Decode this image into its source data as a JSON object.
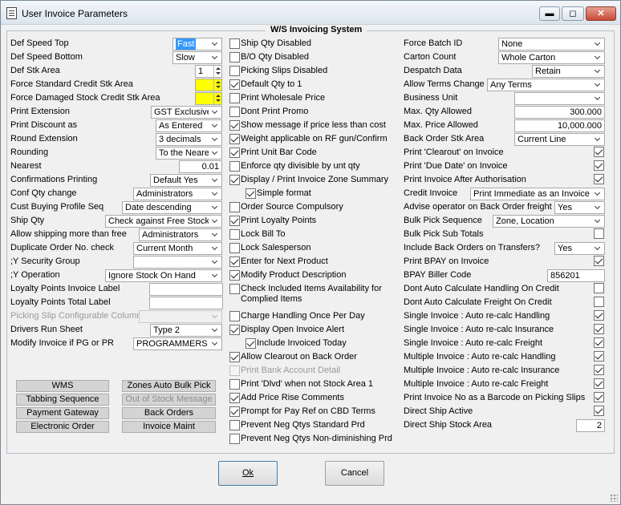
{
  "window": {
    "title": "User Invoice Parameters",
    "minimize": "▬",
    "maximize": "◻",
    "close": "✕"
  },
  "group_title": "W/S Invoicing System",
  "left": {
    "def_speed_top": {
      "label": "Def Speed Top",
      "value": "Fast"
    },
    "def_speed_bottom": {
      "label": "Def Speed Bottom",
      "value": "Slow"
    },
    "def_stk_area": {
      "label": "Def Stk Area",
      "value": "1"
    },
    "force_std_credit": {
      "label": "Force Standard Credit Stk Area",
      "value": ""
    },
    "force_dmg_credit": {
      "label": "Force Damaged Stock Credit Stk Area",
      "value": ""
    },
    "print_extension": {
      "label": "Print Extension",
      "value": "GST Exclusive"
    },
    "print_discount": {
      "label": "Print Discount as",
      "value": "As Entered"
    },
    "round_extension": {
      "label": "Round Extension",
      "value": "3 decimals"
    },
    "rounding": {
      "label": "Rounding",
      "value": "To the Neare"
    },
    "nearest": {
      "label": "Nearest",
      "value": "0.01"
    },
    "confirmations_printing": {
      "label": "Confirmations Printing",
      "value": "Default Yes"
    },
    "conf_qty_change": {
      "label": "Conf Qty change",
      "value": "Administrators"
    },
    "cust_buying_profile": {
      "label": "Cust Buying Profile Seq",
      "value": "Date descending"
    },
    "ship_qty": {
      "label": "Ship Qty",
      "value": "Check against Free Stock"
    },
    "allow_shipping_more": {
      "label": "Allow shipping more than free",
      "value": "Administrators"
    },
    "duplicate_order": {
      "label": "Duplicate Order No. check",
      "value": "Current Month"
    },
    "y_security_group": {
      "label": ";Y Security Group",
      "value": ""
    },
    "y_operation": {
      "label": ";Y Operation",
      "value": "Ignore Stock On Hand"
    },
    "loyalty_invoice_label": {
      "label": "Loyalty Points Invoice Label",
      "value": ""
    },
    "loyalty_total_label": {
      "label": "Loyalty Points Total Label",
      "value": ""
    },
    "picking_slip_column": {
      "label": "Picking Slip Configurable Column",
      "value": ""
    },
    "drivers_run_sheet": {
      "label": "Drivers Run Sheet",
      "value": "Type 2"
    },
    "modify_invoice": {
      "label": "Modify Invoice if PG or PR",
      "value": "PROGRAMMERS"
    }
  },
  "buttons": {
    "wms": "WMS",
    "zones_auto_bulk_pick": "Zones Auto Bulk Pick",
    "tabbing_sequence": "Tabbing Sequence",
    "out_of_stock_message": "Out of Stock Message",
    "payment_gateway": "Payment Gateway",
    "back_orders": "Back Orders",
    "electronic_order": "Electronic Order",
    "invoice_maint": "Invoice Maint",
    "ok": "Ok",
    "cancel": "Cancel"
  },
  "middle": [
    {
      "label": "Ship Qty Disabled",
      "checked": false
    },
    {
      "label": "B/O Qty Disabled",
      "checked": false
    },
    {
      "label": "Picking Slips Disabled",
      "checked": false
    },
    {
      "label": "Default Qty to 1",
      "checked": true
    },
    {
      "label": "Print Wholesale Price",
      "checked": false
    },
    {
      "label": "Dont Print Promo",
      "checked": false
    },
    {
      "label": "Show message if price less than cost",
      "checked": true
    },
    {
      "label": "Weight applicable on RF gun/Confirm",
      "checked": true
    },
    {
      "label": "Print Unit Bar Code",
      "checked": true
    },
    {
      "label": "Enforce qty divisible by unt qty",
      "checked": false
    },
    {
      "label": "Display / Print Invoice Zone Summary",
      "checked": true
    },
    {
      "label": "Simple format",
      "checked": true
    },
    {
      "label": "Order Source Compulsory",
      "checked": false
    },
    {
      "label": "Print Loyalty Points",
      "checked": true
    },
    {
      "label": "Lock Bill To",
      "checked": false
    },
    {
      "label": "Lock Salesperson",
      "checked": false
    },
    {
      "label": "Enter for Next Product",
      "checked": true
    },
    {
      "label": "Modify Product Description",
      "checked": true
    },
    {
      "label": "Check Included Items Availability for",
      "label2": "Complied Items",
      "checked": false
    },
    {
      "label": "Charge Handling Once Per Day",
      "checked": false
    },
    {
      "label": "Display Open Invoice Alert",
      "checked": true
    },
    {
      "label": "Include Invoiced Today",
      "checked": true
    },
    {
      "label": "Allow Clearout on Back Order",
      "checked": true
    },
    {
      "label": "Print Bank Account Detail",
      "checked": false
    },
    {
      "label": "Print 'Dlvd' when not Stock Area 1",
      "checked": false
    },
    {
      "label": "Add Price Rise Comments",
      "checked": true
    },
    {
      "label": "Prompt for Pay Ref on CBD Terms",
      "checked": true
    },
    {
      "label": "Prevent Neg Qtys Standard Prd",
      "checked": false
    },
    {
      "label": "Prevent Neg Qtys Non-diminishing Prd",
      "checked": false
    }
  ],
  "right": {
    "force_batch_id": {
      "label": "Force Batch ID",
      "value": "None"
    },
    "carton_count": {
      "label": "Carton Count",
      "value": "Whole Carton"
    },
    "despatch_data": {
      "label": "Despatch Data",
      "value": "Retain"
    },
    "allow_terms_change": {
      "label": "Allow Terms Change",
      "value": "Any Terms"
    },
    "business_unit": {
      "label": "Business Unit",
      "value": ""
    },
    "max_qty": {
      "label": "Max. Qty Allowed",
      "value": "300.000"
    },
    "max_price": {
      "label": "Max. Price Allowed",
      "value": "10,000.000"
    },
    "back_order_stk": {
      "label": "Back Order Stk Area",
      "value": "Current Line"
    },
    "print_clearout": {
      "label": "Print 'Clearout' on Invoice",
      "checked": true
    },
    "print_due_date": {
      "label": "Print 'Due Date' on Invoice",
      "checked": true
    },
    "print_after_auth": {
      "label": "Print Invoice After Authorisation",
      "checked": true
    },
    "credit_invoice": {
      "label": "Credit Invoice",
      "value": "Print Immediate as an Invoice"
    },
    "advise_operator": {
      "label": "Advise operator on Back Order freight",
      "value": "Yes"
    },
    "bulk_pick_sequence": {
      "label": "Bulk Pick Sequence",
      "value": "Zone, Location"
    },
    "bulk_pick_sub_totals": {
      "label": "Bulk Pick Sub Totals",
      "checked": false
    },
    "include_back_orders": {
      "label": "Include Back Orders on Transfers?",
      "value": "Yes"
    },
    "print_bpay": {
      "label": "Print BPAY on Invoice",
      "checked": true
    },
    "bpay_biller_code": {
      "label": "BPAY Biller Code",
      "value": "856201"
    },
    "dont_auto_handling": {
      "label": "Dont Auto Calculate Handling On Credit",
      "checked": false
    },
    "dont_auto_freight": {
      "label": "Dont Auto Calculate Freight On Credit",
      "checked": false
    },
    "single_handling": {
      "label": "Single Invoice : Auto re-calc Handling",
      "checked": true
    },
    "single_insurance": {
      "label": "Single Invoice : Auto re-calc Insurance",
      "checked": true
    },
    "single_freight": {
      "label": "Single Invoice : Auto re-calc Freight",
      "checked": true
    },
    "multi_handling": {
      "label": "Multiple Invoice : Auto re-calc Handling",
      "checked": true
    },
    "multi_insurance": {
      "label": "Multiple Invoice : Auto re-calc Insurance",
      "checked": true
    },
    "multi_freight": {
      "label": "Multiple Invoice : Auto re-calc Freight",
      "checked": true
    },
    "print_barcode": {
      "label": "Print Invoice No as a Barcode on Picking Slips",
      "checked": true
    },
    "direct_ship_active": {
      "label": "Direct Ship Active",
      "checked": true
    },
    "direct_ship_stock_area": {
      "label": "Direct Ship Stock Area",
      "value": "2"
    }
  }
}
